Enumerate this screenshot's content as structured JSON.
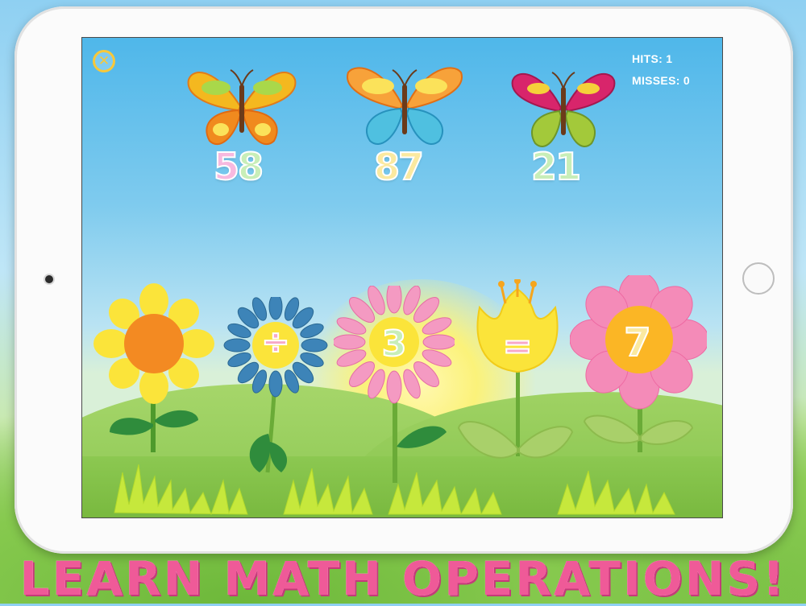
{
  "game": {
    "close_icon": "close-icon",
    "hits_label": "HITS: 1",
    "misses_label": "MISSES: 0"
  },
  "butterflies": [
    {
      "digits": [
        "5",
        "8"
      ],
      "digit_colors": [
        "#f7b9df",
        "#c8eeb8"
      ]
    },
    {
      "digits": [
        "8",
        "7"
      ],
      "digit_colors": [
        "#fbe9a0",
        "#fbe9a0"
      ]
    },
    {
      "digits": [
        "2",
        "1"
      ],
      "digit_colors": [
        "#c8eeb8",
        "#c8eeb8"
      ]
    }
  ],
  "flowers": [
    {
      "label": ""
    },
    {
      "label": "÷"
    },
    {
      "label": "3"
    },
    {
      "label": "="
    },
    {
      "label": "7"
    }
  ],
  "banner": {
    "title": "LEARN MATH OPERATIONS!"
  },
  "colors": {
    "title_pink": "#ef5a98",
    "score_text": "#ffffff",
    "close_ring": "#f7c83a"
  }
}
